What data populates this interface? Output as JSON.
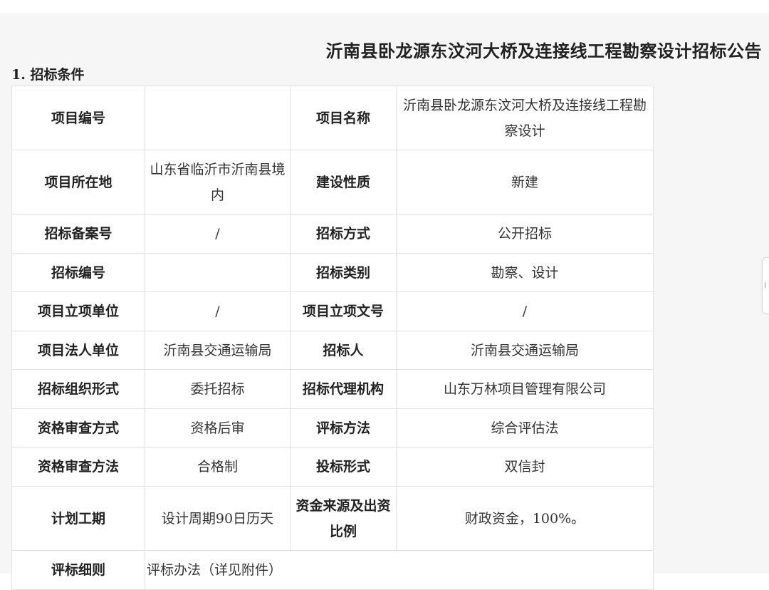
{
  "title": "沂南县卧龙源东汶河大桥及连接线工程勘察设计招标公告",
  "section_heading": "1. 招标条件",
  "rows": [
    {
      "l1": "项目编号",
      "v1": "",
      "l2": "项目名称",
      "v2": "沂南县卧龙源东汶河大桥及连接线工程勘察设计"
    },
    {
      "l1": "项目所在地",
      "v1": "山东省临沂市沂南县境内",
      "l2": "建设性质",
      "v2": "新建"
    },
    {
      "l1": "招标备案号",
      "v1": "/",
      "l2": "招标方式",
      "v2": "公开招标"
    },
    {
      "l1": "招标编号",
      "v1": "",
      "l2": "招标类别",
      "v2": "勘察、设计"
    },
    {
      "l1": "项目立项单位",
      "v1": "/",
      "l2": "项目立项文号",
      "v2": "/"
    },
    {
      "l1": "项目法人单位",
      "v1": "沂南县交通运输局",
      "l2": "招标人",
      "v2": "沂南县交通运输局"
    },
    {
      "l1": "招标组织形式",
      "v1": "委托招标",
      "l2": "招标代理机构",
      "v2": "山东万林项目管理有限公司"
    },
    {
      "l1": "资格审查方式",
      "v1": "资格后审",
      "l2": "评标方法",
      "v2": "综合评估法"
    },
    {
      "l1": "资格审查方法",
      "v1": "合格制",
      "l2": "投标形式",
      "v2": "双信封"
    },
    {
      "l1": "计划工期",
      "v1": "设计周期90日历天",
      "l2": "资金来源及出资比例",
      "v2": "财政资金，100%。"
    }
  ],
  "last_row": {
    "label": "评标细则",
    "value": "评标办法（详见附件）"
  }
}
